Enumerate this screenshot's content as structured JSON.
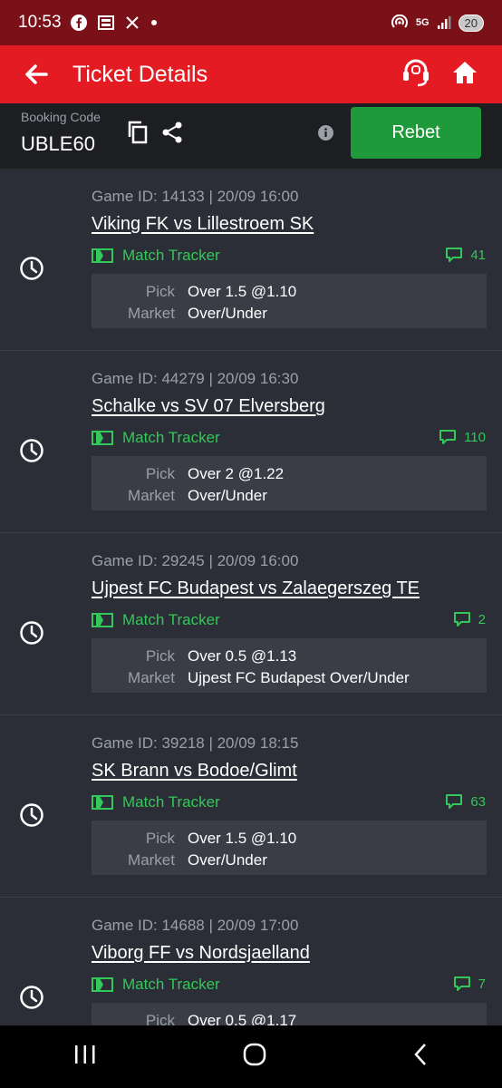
{
  "status_bar": {
    "time": "10:53",
    "battery": "20",
    "network": "5G"
  },
  "header": {
    "title": "Ticket Details"
  },
  "booking": {
    "label": "Booking Code",
    "code": "UBLE60",
    "rebet_label": "Rebet"
  },
  "tracker_label": "Match Tracker",
  "pick_label": "Pick",
  "market_label": "Market",
  "games": [
    {
      "game_id": "Game ID: 14133 | 20/09 16:00",
      "teams": "Viking FK vs Lillestroem SK",
      "comments": "41",
      "pick": "Over 1.5 @1.10",
      "market": "Over/Under"
    },
    {
      "game_id": "Game ID: 44279 | 20/09 16:30",
      "teams": "Schalke vs SV 07 Elversberg",
      "comments": "110",
      "pick": "Over 2 @1.22",
      "market": "Over/Under"
    },
    {
      "game_id": "Game ID: 29245 | 20/09 16:00",
      "teams": "Ujpest FC Budapest vs Zalaegerszeg TE",
      "comments": "2",
      "pick": "Over 0.5 @1.13",
      "market": "Ujpest FC Budapest Over/Under"
    },
    {
      "game_id": "Game ID: 39218 | 20/09 18:15",
      "teams": "SK Brann vs Bodoe/Glimt",
      "comments": "63",
      "pick": "Over 1.5 @1.10",
      "market": "Over/Under"
    },
    {
      "game_id": "Game ID: 14688 | 20/09 17:00",
      "teams": "Viborg FF vs Nordsjaelland",
      "comments": "7",
      "pick": "Over 0.5 @1.17",
      "market": ""
    }
  ],
  "colors": {
    "header": "#e41b23",
    "status_bar": "#7a1119",
    "accent_green": "#34c759",
    "rebet": "#1f9a3a"
  }
}
